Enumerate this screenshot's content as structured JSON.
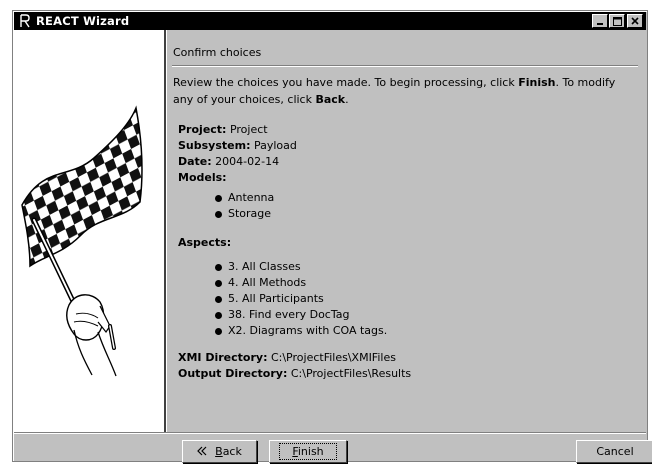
{
  "window": {
    "title": "REACT Wizard"
  },
  "page": {
    "heading": "Confirm choices",
    "intro_pre": "Review the choices you have made. To begin processing, click ",
    "intro_finish": "Finish",
    "intro_mid": ". To modify any of your choices, click ",
    "intro_back": "Back",
    "intro_end": "."
  },
  "summary": {
    "project_label": "Project:",
    "project_value": "Project",
    "subsystem_label": "Subsystem:",
    "subsystem_value": "Payload",
    "date_label": "Date:",
    "date_value": "2004-02-14",
    "models_label": "Models:",
    "models": [
      "Antenna",
      "Storage"
    ],
    "aspects_label": "Aspects:",
    "aspects": [
      "3. All Classes",
      "4. All Methods",
      "5. All Participants",
      "38. Find every DocTag",
      "X2. Diagrams with COA tags."
    ],
    "xmi_label": "XMI Directory:",
    "xmi_value": "C:\\ProjectFiles\\XMIFiles",
    "output_label": "Output Directory:",
    "output_value": "C:\\ProjectFiles\\Results"
  },
  "buttons": {
    "back_first": "B",
    "back_rest": "ack",
    "finish_first": "F",
    "finish_rest": "inish",
    "cancel": "Cancel"
  },
  "icons": {
    "app": "react-r-icon",
    "minimize": "minimize-icon",
    "maximize": "maximize-icon",
    "close": "close-icon",
    "back_chevron": "double-chevron-left-icon",
    "illustration": "checkered-flag-icon"
  }
}
